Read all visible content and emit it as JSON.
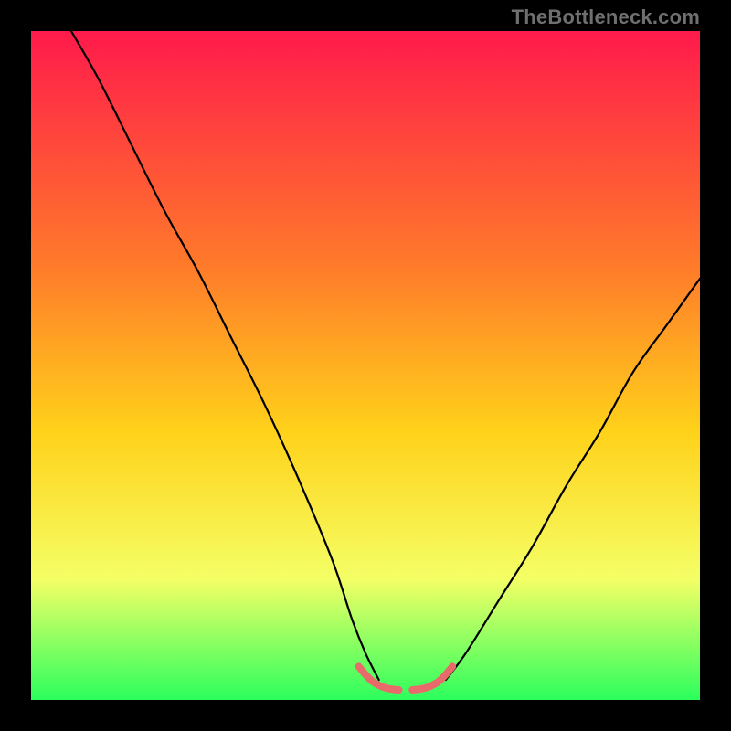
{
  "watermark": "TheBottleneck.com",
  "colors": {
    "gradient_top": "#ff1a4b",
    "gradient_mid1": "#ff7a2a",
    "gradient_mid2": "#ffd21a",
    "gradient_mid3": "#f4ff66",
    "gradient_bottom": "#2bff5d",
    "curve": "#000000",
    "bottom_accent": "#e96a6a",
    "frame": "#000000",
    "watermark": "#6f6f6f"
  },
  "chart_data": {
    "type": "line",
    "title": "",
    "xlabel": "",
    "ylabel": "",
    "xlim": [
      0,
      100
    ],
    "ylim": [
      0,
      100
    ],
    "grid": false,
    "legend": false,
    "series": [
      {
        "name": "left-curve",
        "x": [
          6,
          10,
          15,
          20,
          25,
          30,
          35,
          40,
          45,
          48,
          50,
          52
        ],
        "y": [
          100,
          93,
          83,
          73,
          64,
          54,
          44,
          33,
          21,
          12,
          7,
          3
        ]
      },
      {
        "name": "right-curve",
        "x": [
          62,
          65,
          70,
          75,
          80,
          85,
          90,
          95,
          100
        ],
        "y": [
          3,
          7,
          15,
          23,
          32,
          40,
          49,
          56,
          63
        ]
      },
      {
        "name": "bottom-accent-left",
        "x": [
          49,
          50,
          51,
          52,
          53,
          54,
          55
        ],
        "y": [
          5,
          3.8,
          2.8,
          2.2,
          1.8,
          1.6,
          1.5
        ]
      },
      {
        "name": "bottom-accent-right",
        "x": [
          57,
          58,
          59,
          60,
          61,
          62,
          63
        ],
        "y": [
          1.5,
          1.6,
          1.8,
          2.2,
          2.8,
          3.8,
          5
        ]
      }
    ]
  }
}
